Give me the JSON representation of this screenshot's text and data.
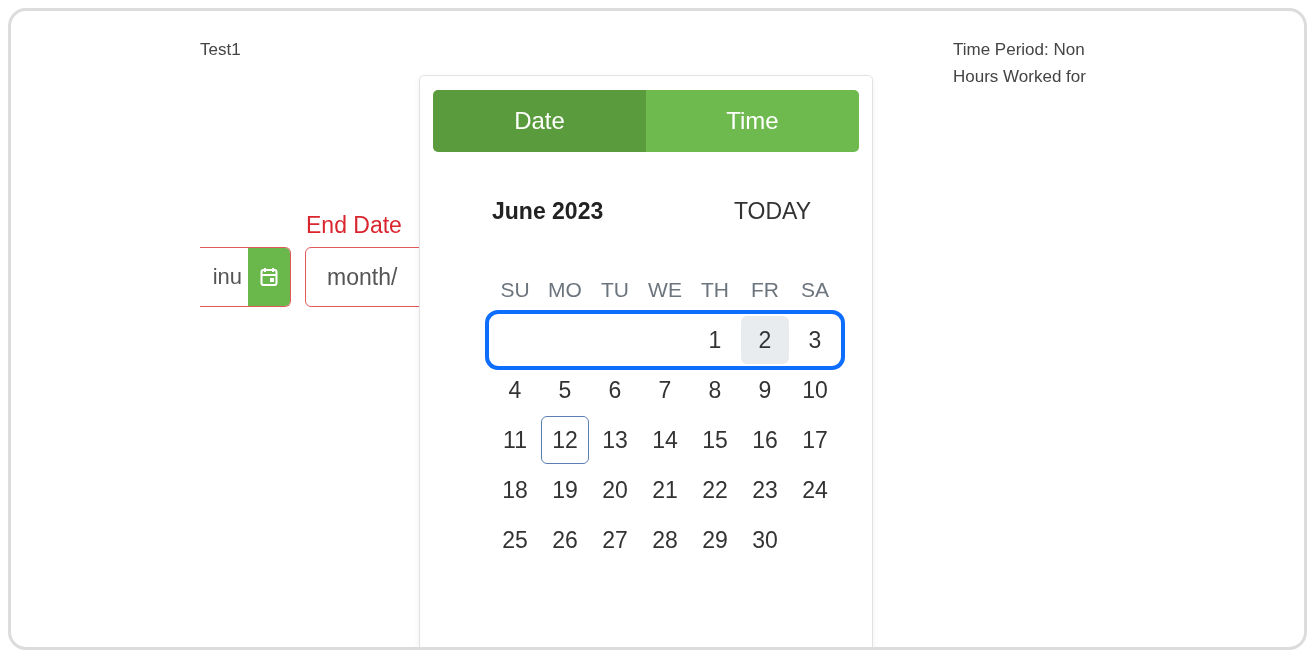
{
  "form": {
    "title": "Test1",
    "start_field": {
      "value": "inu",
      "invalid": true
    },
    "end_date": {
      "label": "End Date",
      "value": "month/",
      "invalid": true
    }
  },
  "summary": [
    "Time Period: Non",
    "Hours Worked for"
  ],
  "picker": {
    "tabs": [
      {
        "label": "Date",
        "selected": true
      },
      {
        "label": "Time",
        "selected": false
      }
    ],
    "month": "June 2023",
    "today_button": "TODAY",
    "weekdays": [
      "SU",
      "MO",
      "TU",
      "WE",
      "TH",
      "FR",
      "SA"
    ],
    "weeks": [
      {
        "focused": true,
        "days": [
          {
            "kind": "blank"
          },
          {
            "kind": "blank"
          },
          {
            "kind": "blank"
          },
          {
            "kind": "blank"
          },
          {
            "kind": "day",
            "label": "1",
            "selected": false,
            "today": false
          },
          {
            "kind": "day",
            "label": "2",
            "selected": true,
            "today": false
          },
          {
            "kind": "day",
            "label": "3",
            "selected": false,
            "today": false
          }
        ]
      },
      {
        "focused": false,
        "days": [
          {
            "kind": "day",
            "label": "4",
            "selected": false,
            "today": false
          },
          {
            "kind": "day",
            "label": "5",
            "selected": false,
            "today": false
          },
          {
            "kind": "day",
            "label": "6",
            "selected": false,
            "today": false
          },
          {
            "kind": "day",
            "label": "7",
            "selected": false,
            "today": false
          },
          {
            "kind": "day",
            "label": "8",
            "selected": false,
            "today": false
          },
          {
            "kind": "day",
            "label": "9",
            "selected": false,
            "today": false
          },
          {
            "kind": "day",
            "label": "10",
            "selected": false,
            "today": false
          }
        ]
      },
      {
        "focused": false,
        "days": [
          {
            "kind": "day",
            "label": "11",
            "selected": false,
            "today": false
          },
          {
            "kind": "day",
            "label": "12",
            "selected": false,
            "today": true
          },
          {
            "kind": "day",
            "label": "13",
            "selected": false,
            "today": false
          },
          {
            "kind": "day",
            "label": "14",
            "selected": false,
            "today": false
          },
          {
            "kind": "day",
            "label": "15",
            "selected": false,
            "today": false
          },
          {
            "kind": "day",
            "label": "16",
            "selected": false,
            "today": false
          },
          {
            "kind": "day",
            "label": "17",
            "selected": false,
            "today": false
          }
        ]
      },
      {
        "focused": false,
        "days": [
          {
            "kind": "day",
            "label": "18",
            "selected": false,
            "today": false
          },
          {
            "kind": "day",
            "label": "19",
            "selected": false,
            "today": false
          },
          {
            "kind": "day",
            "label": "20",
            "selected": false,
            "today": false
          },
          {
            "kind": "day",
            "label": "21",
            "selected": false,
            "today": false
          },
          {
            "kind": "day",
            "label": "22",
            "selected": false,
            "today": false
          },
          {
            "kind": "day",
            "label": "23",
            "selected": false,
            "today": false
          },
          {
            "kind": "day",
            "label": "24",
            "selected": false,
            "today": false
          }
        ]
      },
      {
        "focused": false,
        "days": [
          {
            "kind": "day",
            "label": "25",
            "selected": false,
            "today": false
          },
          {
            "kind": "day",
            "label": "26",
            "selected": false,
            "today": false
          },
          {
            "kind": "day",
            "label": "27",
            "selected": false,
            "today": false
          },
          {
            "kind": "day",
            "label": "28",
            "selected": false,
            "today": false
          },
          {
            "kind": "day",
            "label": "29",
            "selected": false,
            "today": false
          },
          {
            "kind": "day",
            "label": "30",
            "selected": false,
            "today": false
          }
        ]
      }
    ]
  }
}
